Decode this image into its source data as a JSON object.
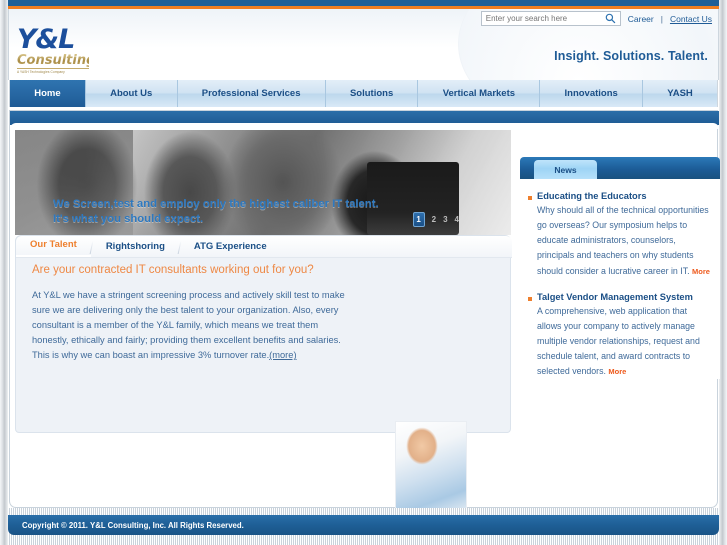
{
  "site": {
    "logo_main": "Y&L",
    "logo_sub": "Consulting",
    "logo_tagline": "A YASH Technologies Company",
    "tagline": "Insight. Solutions. Talent."
  },
  "utility": {
    "search_placeholder": "Enter your search here",
    "search_value": "",
    "search_icon": "search-icon",
    "career_label": "Career",
    "separator": "|",
    "contact_label": "Contact Us"
  },
  "nav": {
    "items": [
      {
        "label": "Home",
        "active": true
      },
      {
        "label": "About Us",
        "active": false
      },
      {
        "label": "Professional Services",
        "active": false
      },
      {
        "label": "Solutions",
        "active": false
      },
      {
        "label": "Vertical Markets",
        "active": false
      },
      {
        "label": "Innovations",
        "active": false
      },
      {
        "label": "YASH",
        "active": false
      }
    ]
  },
  "hero": {
    "line1": "We Screen,test and employ only the highest caliber IT talent.",
    "line2": "It's what you should expect.",
    "pager": [
      "1",
      "2",
      "3",
      "4"
    ],
    "active_page": "1"
  },
  "content": {
    "tabs": [
      {
        "label": "Our Talent",
        "active": true
      },
      {
        "label": "Rightshoring",
        "active": false
      },
      {
        "label": "ATG Experience",
        "active": false
      }
    ],
    "heading": "Are your contracted IT consultants working out for you?",
    "paragraph": "At Y&L we have a stringent screening process and actively skill test to make sure we are delivering only the best talent to your organization. Also, every consultant is a member of the Y&L family, which means we treat them honestly, ethically and fairly; providing them excellent benefits and salaries. This is why we can boast an impressive 3% turnover rate.",
    "more_label": "(more)"
  },
  "news": {
    "tab_label": "News",
    "items": [
      {
        "title": "Educating the Educators",
        "text": "Why should all of the technical opportunities go overseas? Our symposium helps to educate administrators, counselors, principals and teachers on why students should consider a lucrative career in IT.",
        "more_label": "More"
      },
      {
        "title": "Talget Vendor Management System",
        "text": "A comprehensive, web application that allows your company to actively manage multiple vendor relationships, request and schedule talent, and award contracts to selected vendors.",
        "more_label": "More"
      }
    ]
  },
  "footer": {
    "copyright": "Copyright © 2011. Y&L Consulting, Inc. All Rights Reserved."
  },
  "colors": {
    "brand_blue": "#1f5b96",
    "accent_orange": "#ee7f2d",
    "nav_active": "#1f5b96",
    "gold": "#b79a55"
  }
}
